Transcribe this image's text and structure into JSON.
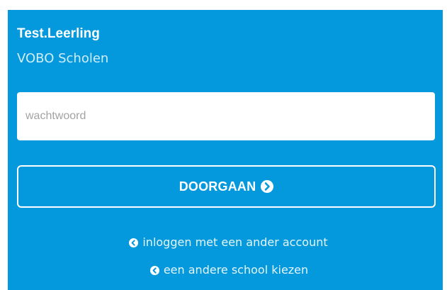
{
  "account": {
    "user_name": "Test.Leerling",
    "school_name": "VOBO Scholen"
  },
  "password": {
    "value": "",
    "placeholder": "wachtwoord"
  },
  "continue_button": {
    "label": "DOORGAAN",
    "icon": "chevron-right-circle-icon"
  },
  "links": {
    "other_account": {
      "label": "inloggen met een ander account",
      "icon": "chevron-left-circle-icon"
    },
    "other_school": {
      "label": "een andere school kiezen",
      "icon": "chevron-left-circle-icon"
    }
  },
  "colors": {
    "panel_background": "#0399dc",
    "text": "#ffffff",
    "input_background": "#ffffff",
    "placeholder": "#a3a3a3"
  }
}
